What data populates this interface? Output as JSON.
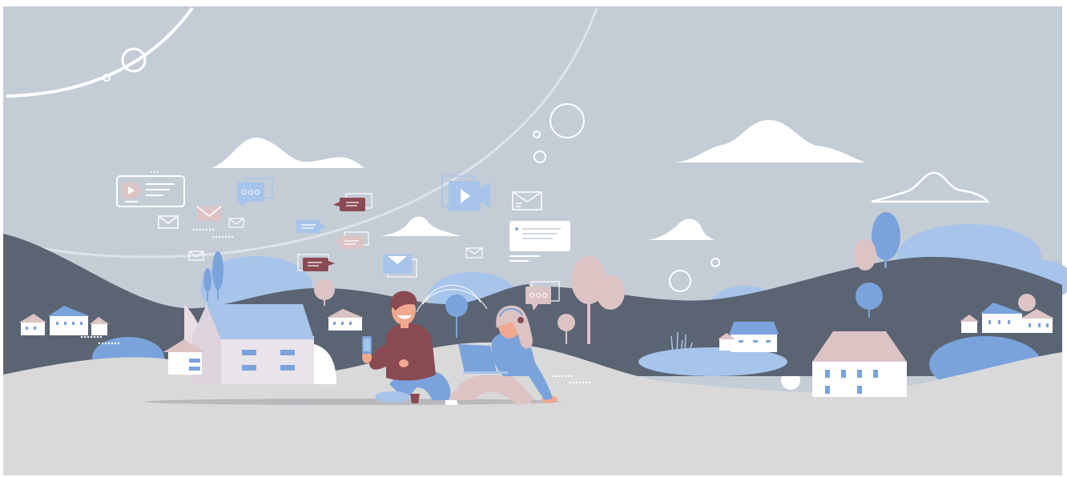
{
  "illustration": {
    "subject": "two-people-with-devices-in-countryside",
    "colors": {
      "sky": "#c4ccd6",
      "ground": "#d9d9da",
      "dark_hill": "#5b6473",
      "blue_accent": "#7aa3dc",
      "light_blue": "#a7c4eb",
      "pink_accent": "#dcc3c4",
      "maroon": "#8a4a52",
      "white": "#ffffff"
    },
    "icons": [
      "video-player-icon",
      "chat-bubble-icon",
      "envelope-icon",
      "message-bubble-icon",
      "video-camera-icon",
      "notification-card-icon",
      "typing-bubble-icon",
      "cloud-icon",
      "house-icon",
      "tree-icon",
      "smartphone-icon",
      "laptop-icon",
      "headphones-icon",
      "pond-icon"
    ]
  }
}
